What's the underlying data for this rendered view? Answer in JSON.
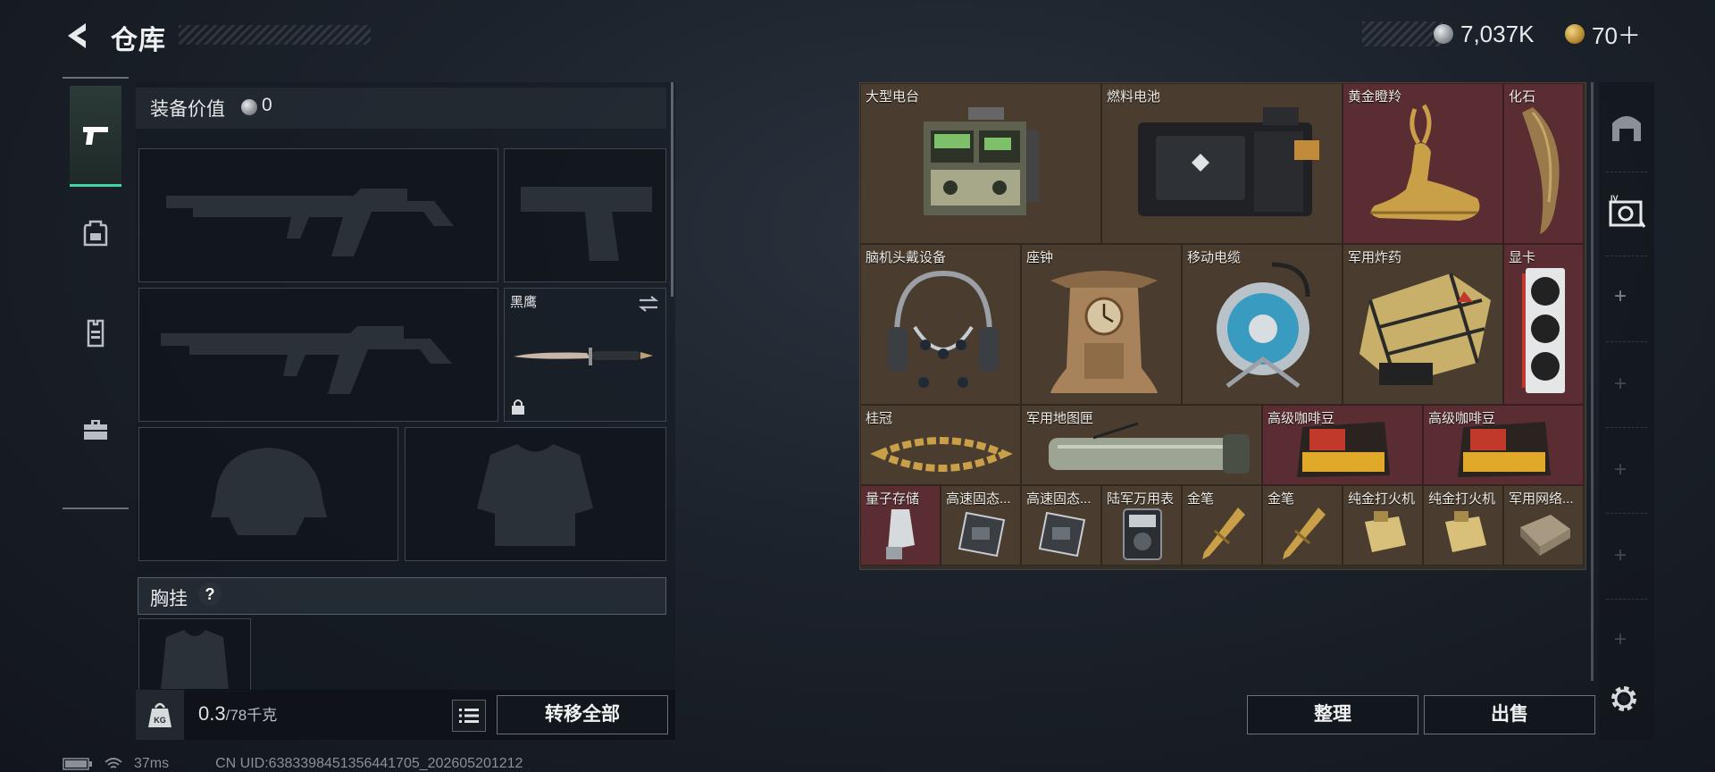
{
  "header": {
    "title": "仓库",
    "silver_amount": "7,037K",
    "gold_amount": "70＋"
  },
  "tabs": [
    {
      "name": "weapon",
      "icon": "pistol-icon"
    },
    {
      "name": "gear",
      "icon": "backpack-icon"
    },
    {
      "name": "armor",
      "icon": "vest-icon"
    },
    {
      "name": "toolbox",
      "icon": "toolbox-icon"
    }
  ],
  "loadout": {
    "equip_value_label": "装备价值",
    "equip_value": "0",
    "melee_name": "黑鹰",
    "chest_label": "胸挂",
    "chest_help": "?",
    "weight_value": "0.3",
    "weight_capacity": "/78千克",
    "transfer_all_label": "转移全部"
  },
  "storage": {
    "items": [
      {
        "name": "大型电台",
        "color": "brown",
        "icon": "radio-icon"
      },
      {
        "name": "燃料电池",
        "color": "brown",
        "icon": "fuel-cell-icon"
      },
      {
        "name": "黄金瞪羚",
        "color": "red",
        "icon": "gazelle-icon"
      },
      {
        "name": "化石",
        "color": "red",
        "icon": "fossil-claw-icon"
      },
      {
        "name": "脑机头戴设备",
        "color": "brown",
        "icon": "headset-icon"
      },
      {
        "name": "座钟",
        "color": "brown",
        "icon": "clock-icon"
      },
      {
        "name": "移动电缆",
        "color": "brown",
        "icon": "cable-reel-icon"
      },
      {
        "name": "军用炸药",
        "color": "brown",
        "icon": "explosive-crate-icon"
      },
      {
        "name": "显卡",
        "color": "red",
        "icon": "gpu-icon"
      },
      {
        "name": "桂冠",
        "color": "brown",
        "icon": "laurel-icon"
      },
      {
        "name": "军用地图匣",
        "color": "brown",
        "icon": "map-tube-icon"
      },
      {
        "name": "高级咖啡豆",
        "color": "red",
        "icon": "coffee-bag-icon"
      },
      {
        "name": "高级咖啡豆",
        "color": "red",
        "icon": "coffee-bag-icon"
      },
      {
        "name": "量子存储",
        "color": "red",
        "icon": "usb-drive-icon"
      },
      {
        "name": "高速固态...",
        "color": "brown",
        "icon": "ssd-icon"
      },
      {
        "name": "高速固态...",
        "color": "brown",
        "icon": "ssd-icon"
      },
      {
        "name": "陆军万用表",
        "color": "brown",
        "icon": "multimeter-icon"
      },
      {
        "name": "金笔",
        "color": "brown",
        "icon": "gold-pen-icon"
      },
      {
        "name": "金笔",
        "color": "brown",
        "icon": "gold-pen-icon"
      },
      {
        "name": "纯金打火机",
        "color": "brown",
        "icon": "lighter-icon"
      },
      {
        "name": "纯金打火机",
        "color": "brown",
        "icon": "lighter-icon"
      },
      {
        "name": "军用网络...",
        "color": "brown",
        "icon": "network-device-icon"
      }
    ],
    "sort_label": "整理",
    "sell_label": "出售"
  },
  "colors": {
    "cell_brown": "#4a3d30",
    "cell_red": "#5a2d33",
    "accent_green": "#3fd6a6"
  },
  "status": {
    "ping": "37ms",
    "uid": "CN UID:6383398451356441705_202605201212"
  }
}
